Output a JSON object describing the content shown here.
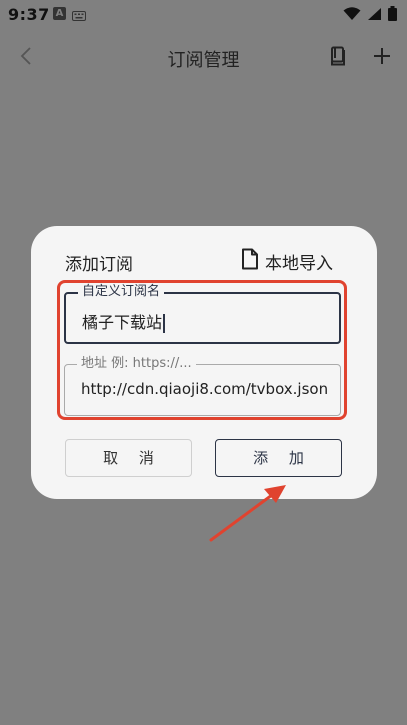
{
  "status_bar": {
    "time": "9:37",
    "notification_letter": "A",
    "icons": [
      "keyboard-icon",
      "wifi-icon",
      "signal-icon",
      "battery-icon"
    ]
  },
  "app_bar": {
    "title": "订阅管理",
    "icons": [
      "back-icon",
      "book-icon",
      "plus-icon"
    ]
  },
  "dialog": {
    "title": "添加订阅",
    "import_label": "本地导入",
    "name_field": {
      "label": "自定义订阅名",
      "value": "橘子下载站"
    },
    "url_field": {
      "label": "地址 例: https://...",
      "value": "http://cdn.qiaoji8.com/tvbox.json"
    },
    "cancel_label": "取 消",
    "add_label": "添 加"
  },
  "colors": {
    "scrim": "#808080",
    "dialog_bg": "#f5f5f5",
    "accent": "#2c3446",
    "annotation_red": "#e0432f"
  }
}
